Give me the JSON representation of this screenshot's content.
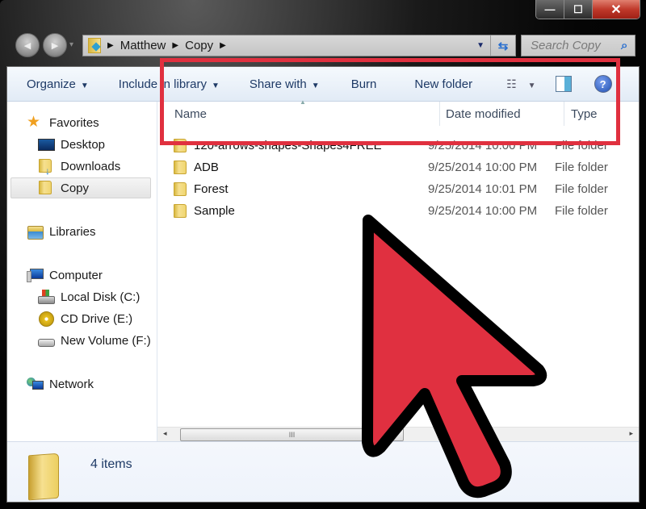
{
  "window": {
    "controls": {
      "minimize": "—",
      "maximize": "☐",
      "close": "✕"
    }
  },
  "navigation": {
    "back_icon": "◀",
    "forward_icon": "▶",
    "recent_icon": "▾",
    "breadcrumb": [
      "Matthew",
      "Copy"
    ],
    "refresh_icon": "⇆",
    "search_placeholder": "Search Copy",
    "search_icon": "⚲"
  },
  "toolbar": {
    "organize": "Organize",
    "include_in_library": "Include in library",
    "share_with": "Share with",
    "burn": "Burn",
    "new_folder": "New folder",
    "caret": "▼",
    "views_icon": "☷",
    "preview_pane_icon": "▯",
    "help_icon": "?"
  },
  "sidebar": {
    "favorites": {
      "label": "Favorites",
      "items": [
        {
          "label": "Desktop",
          "icon": "desktop-icon"
        },
        {
          "label": "Downloads",
          "icon": "downloads-icon"
        },
        {
          "label": "Copy",
          "icon": "folder-icon",
          "selected": true
        }
      ]
    },
    "libraries": {
      "label": "Libraries"
    },
    "computer": {
      "label": "Computer",
      "items": [
        {
          "label": "Local Disk (C:)",
          "icon": "local-disk-icon"
        },
        {
          "label": "CD Drive (E:)",
          "icon": "cd-drive-icon"
        },
        {
          "label": "New Volume (F:)",
          "icon": "drive-icon"
        }
      ]
    },
    "network": {
      "label": "Network"
    }
  },
  "file_list": {
    "columns": {
      "name": "Name",
      "date_modified": "Date modified",
      "type": "Type"
    },
    "sort_indicator": "▲",
    "rows": [
      {
        "name": "120-arrows-shapes-Shapes4FREE",
        "date": "9/25/2014 10:00 PM",
        "type": "File folder"
      },
      {
        "name": "ADB",
        "date": "9/25/2014 10:00 PM",
        "type": "File folder"
      },
      {
        "name": "Forest",
        "date": "9/25/2014 10:01 PM",
        "type": "File folder"
      },
      {
        "name": "Sample",
        "date": "9/25/2014 10:00 PM",
        "type": "File folder"
      }
    ]
  },
  "scrollbar": {
    "left_arrow": "◂",
    "right_arrow": "▸",
    "grip": "III"
  },
  "details_pane": {
    "item_count": "4 items"
  },
  "annotation": {
    "highlight_color": "#e0303f",
    "cursor_color": "#e03040"
  }
}
